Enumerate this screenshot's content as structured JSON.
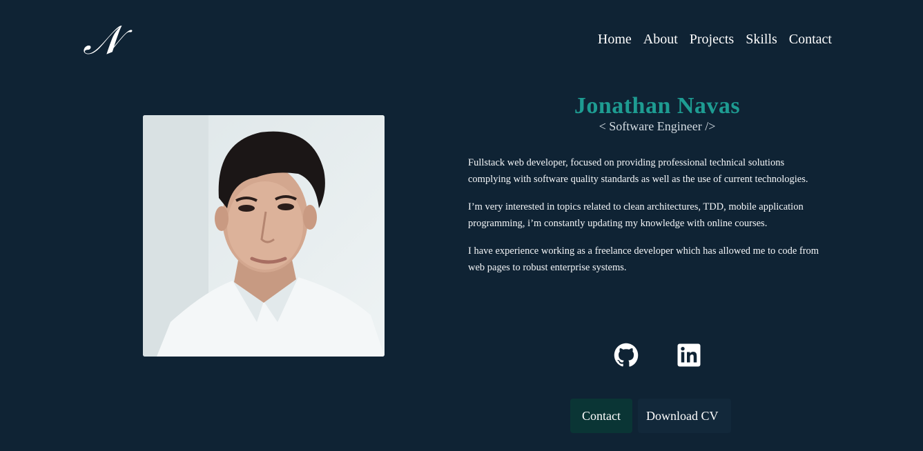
{
  "header": {
    "logo": "𝒩",
    "nav": [
      {
        "label": "Home"
      },
      {
        "label": "About"
      },
      {
        "label": "Projects"
      },
      {
        "label": "Skills"
      },
      {
        "label": "Contact"
      }
    ]
  },
  "profile": {
    "name": "Jonathan Navas",
    "role": "< Software Engineer />",
    "bio": [
      "Fullstack web developer, focused on providing professional technical solutions complying with software quality standards as well as the use of current technologies.",
      "I’m very interested in topics related to clean architectures, TDD, mobile application programming, i’m constantly updating my knowledge with online courses.",
      "I have experience working as a freelance developer which has allowed me to code from web pages to robust enterprise systems."
    ]
  },
  "socials": [
    {
      "icon": "github-icon"
    },
    {
      "icon": "linkedin-icon"
    }
  ],
  "actions": {
    "contact_label": "Contact",
    "cv_label": "Download CV"
  },
  "colors": {
    "background": "#0f2334",
    "accent": "#1e9c92",
    "contact_button": "#0a3535",
    "cv_button": "#12283a"
  }
}
